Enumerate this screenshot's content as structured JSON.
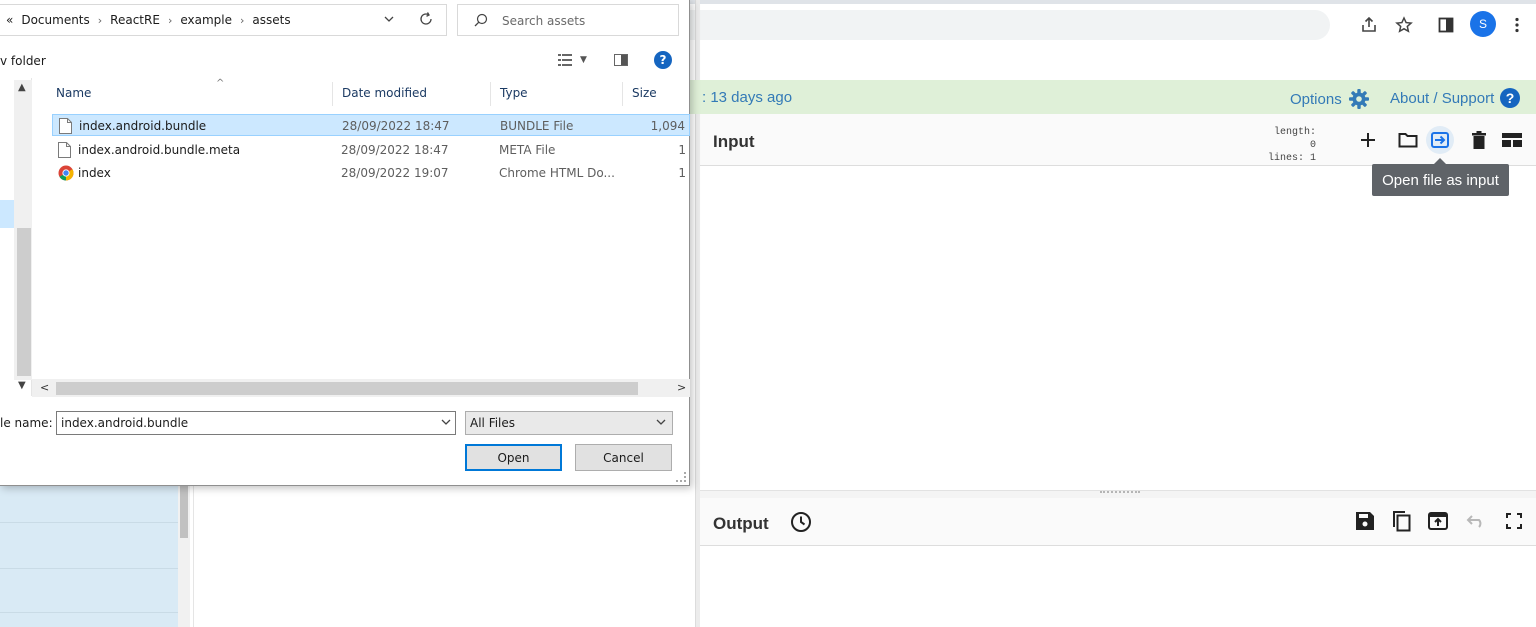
{
  "browser": {
    "profile_initial": "S",
    "icons": [
      "share-icon",
      "star-icon",
      "side-panel-icon",
      "kebab-menu-icon"
    ]
  },
  "app": {
    "banner_text": ": 13 days ago",
    "options_label": "Options",
    "about_label": "About / Support",
    "input": {
      "title": "Input",
      "length_label": "length:",
      "length_value": "0",
      "lines_label": "lines:",
      "lines_value": "1",
      "tooltip": "Open file as input"
    },
    "output": {
      "title": "Output"
    },
    "colors": {
      "banner_bg": "#dff0d8",
      "link": "#337ab7",
      "ops_bg": "#d9eaf5"
    }
  },
  "dialog": {
    "breadcrumb": [
      "«",
      "Documents",
      "ReactRE",
      "example",
      "assets"
    ],
    "search_placeholder": "Search assets",
    "new_folder_label": "v folder",
    "help_label": "?",
    "columns": [
      "Name",
      "Date modified",
      "Type",
      "Size"
    ],
    "files": [
      {
        "name": "index.android.bundle",
        "date": "28/09/2022 18:47",
        "type": "BUNDLE File",
        "size": "1,094",
        "icon": "file-icon",
        "selected": true
      },
      {
        "name": "index.android.bundle.meta",
        "date": "28/09/2022 18:47",
        "type": "META File",
        "size": "1",
        "icon": "file-icon",
        "selected": false
      },
      {
        "name": "index",
        "date": "28/09/2022 19:07",
        "type": "Chrome HTML Do...",
        "size": "1",
        "icon": "chrome-icon",
        "selected": false
      }
    ],
    "filename_label": "le name:",
    "filename_value": "index.android.bundle",
    "filetype_value": "All Files",
    "open_label": "Open",
    "cancel_label": "Cancel"
  }
}
